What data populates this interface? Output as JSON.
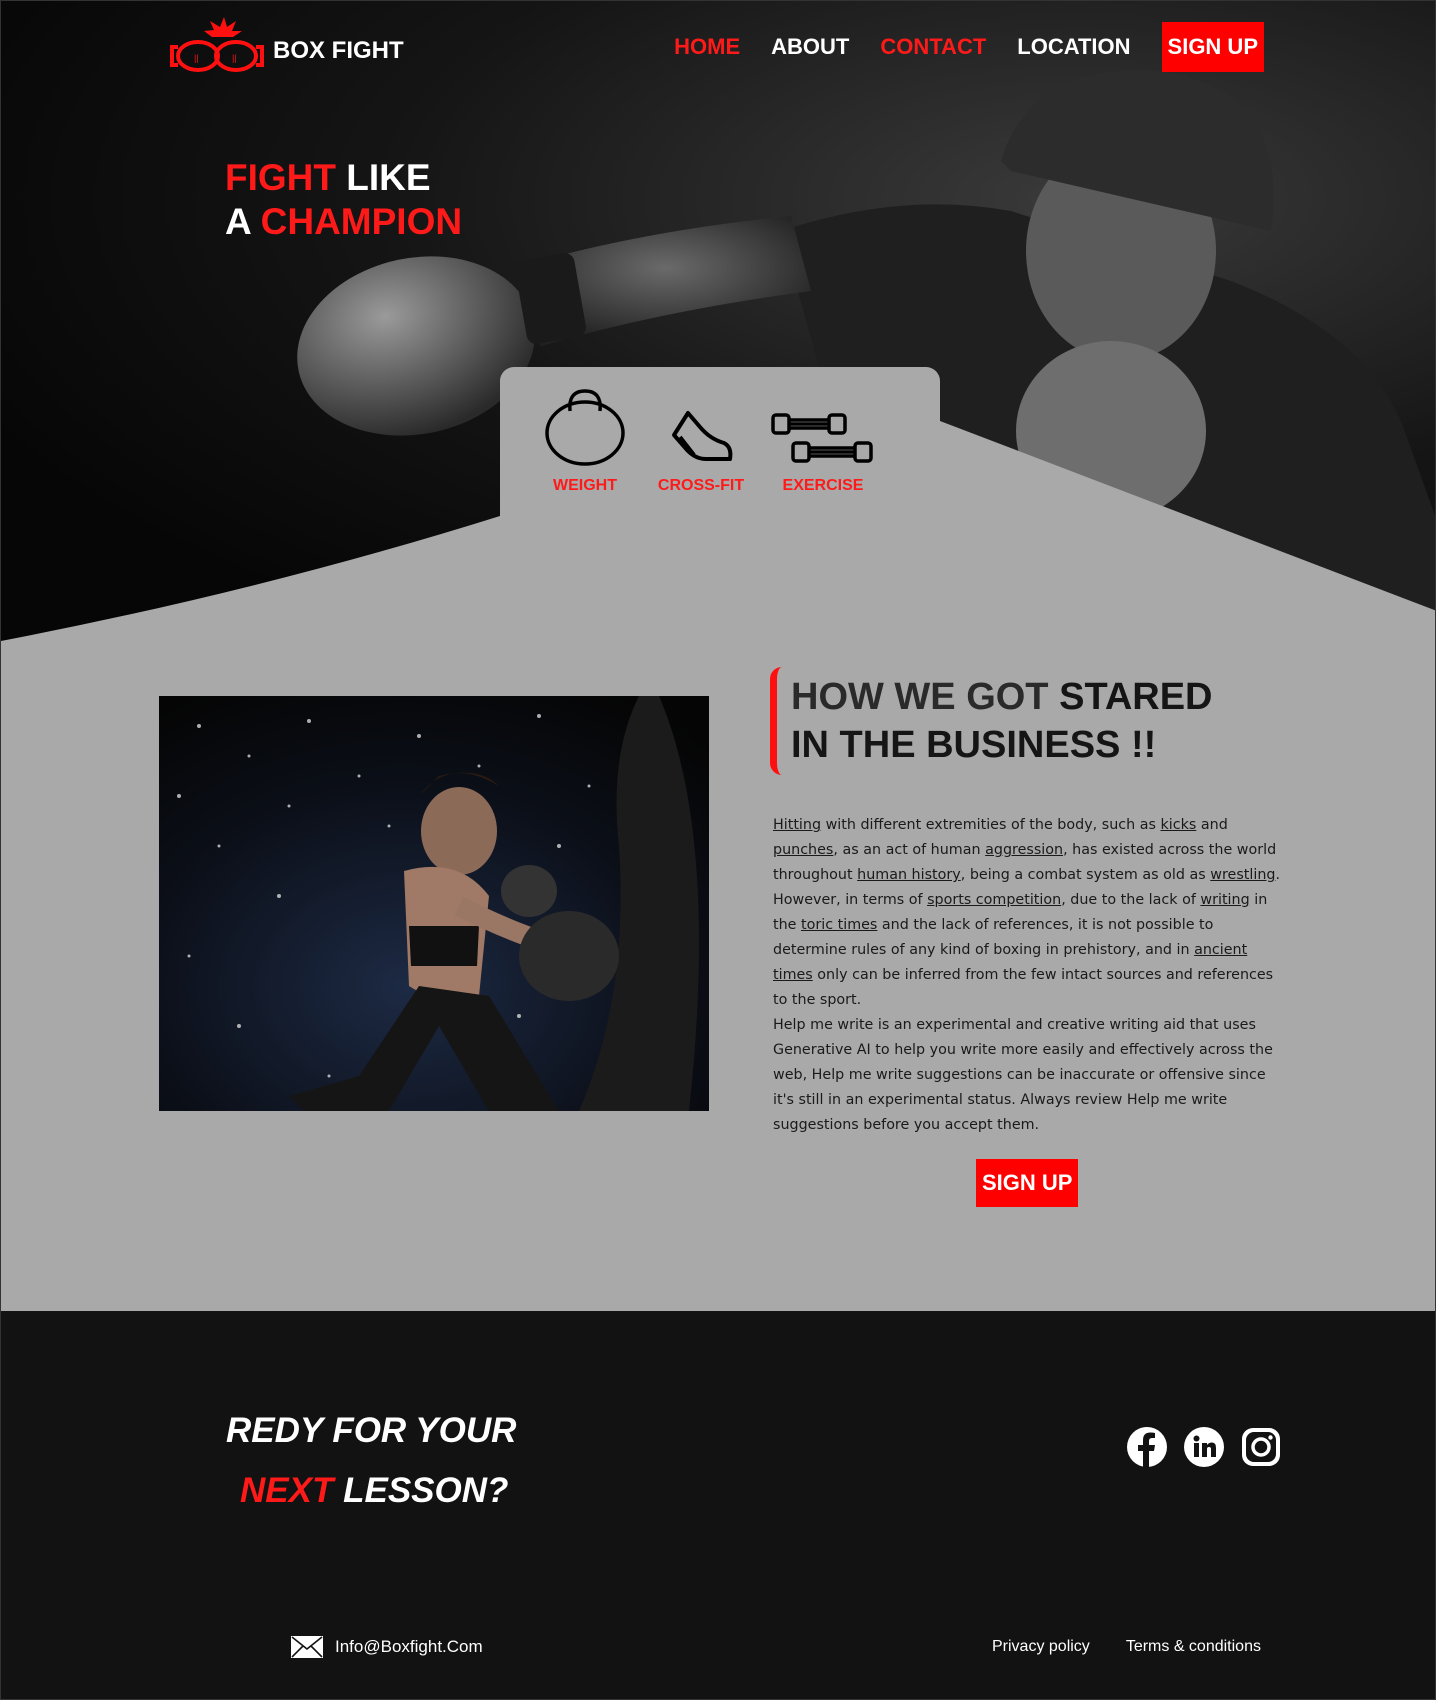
{
  "brand": {
    "name": "BOX FIGHT"
  },
  "nav": {
    "home": "HOME",
    "about": "ABOUT",
    "contact": "CONTACT",
    "location": "LOCATION",
    "signup": "SIGN UP"
  },
  "hero": {
    "w1": "FIGHT",
    "w2": "LIKE",
    "w3": "A",
    "w4": "CHAMPION"
  },
  "features": [
    {
      "label": "WEIGHT",
      "icon": "kettlebell-icon"
    },
    {
      "label": "CROSS-FIT",
      "icon": "sneaker-icon"
    },
    {
      "label": "EXERCISE",
      "icon": "dumbbells-icon"
    }
  ],
  "about": {
    "title_part1": "HOW WE GOT",
    "title_part2": "STARED",
    "title_line2": "IN THE BUSINESS !!",
    "p1": {
      "t1": "Hitting",
      "t2": " with different extremities of the body, such as ",
      "t3": "kicks",
      "t4": " and ",
      "t5": "punches",
      "t6": ", as an act of human ",
      "t7": "aggression",
      "t8": ", has existed across the world throughout ",
      "t9": "human history",
      "t10": ", being a combat system as old as ",
      "t11": "wrestling",
      "t12": ". However, in terms of ",
      "t13": "sports competition",
      "t14": ", due to the lack of ",
      "t15": "writing",
      "t16": " in the ",
      "t17": "toric times",
      "t18": " and the lack of references, it is not possible to determine rules of any kind of boxing in prehistory, and in ",
      "t19": "ancient times",
      "t20": " only can be inferred from the few intact sources and references to the sport."
    },
    "p2": " Help me write is an experimental and creative writing aid that uses Generative AI to help you write more easily and effectively across the web, Help me write suggestions can be inaccurate or offensive since it's still in an experimental status. Always review Help me write suggestions before you accept them.",
    "signup": "SIGN UP"
  },
  "footer": {
    "cta1": "REDY FOR YOUR",
    "cta2a": "NEXT",
    "cta2b": "LESSON?",
    "email": "Info@Boxfight.Com",
    "privacy": "Privacy policy",
    "terms": "Terms & conditions",
    "social": [
      "facebook-icon",
      "linkedin-icon",
      "instagram-icon"
    ]
  },
  "colors": {
    "accent": "#ff0000",
    "panel": "#a9a9a9",
    "footer": "#121212"
  }
}
